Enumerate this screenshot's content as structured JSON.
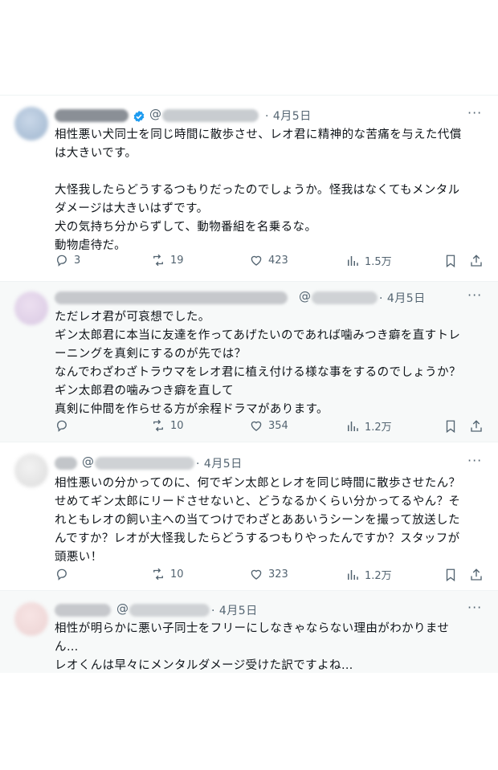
{
  "tweets": [
    {
      "at": "@",
      "date": "· 4月5日",
      "more": "···",
      "text": "相性悪い犬同士を同じ時間に散歩させ、レオ君に精神的な苦痛を与えた代償\nは大きいです。\n\n大怪我したらどうするつもりだったのでしょうか。怪我はなくてもメンタル\nダメージは大きいはずです。\n犬の気持ち分からずして、動物番組を名乗るな。\n動物虐待だ。",
      "replies": "3",
      "reposts": "19",
      "likes": "423",
      "views": "1.5万"
    },
    {
      "at": "@",
      "date": "· 4月5日",
      "more": "···",
      "text": "ただレオ君が可哀想でした。\nギン太郎君に本当に友達を作ってあげたいのであれば噛みつき癖を直すトレ\nーニングを真剣にするのが先では？\nなんでわざわざトラウマをレオ君に植え付ける様な事をするのでしょうか？\nギン太郎君の噛みつき癖を直して\n真剣に仲間を作らせる方が余程ドラマがあります。",
      "replies": "",
      "reposts": "10",
      "likes": "354",
      "views": "1.2万"
    },
    {
      "at": "@",
      "date": "· 4月5日",
      "more": "···",
      "text": "相性悪いの分かってのに、何でギン太郎とレオを同じ時間に散歩させたん？\nせめてギン太郎にリードさせないと、どうなるかくらい分かってるやん？そ\nれともレオの飼い主への当てつけでわざとああいうシーンを撮って放送した\nんですか？レオが大怪我したらどうするつもりやったんですか？スタッフが\n頭悪い！",
      "replies": "",
      "reposts": "10",
      "likes": "323",
      "views": "1.2万"
    },
    {
      "at": "@",
      "date": "· 4月5日",
      "more": "···",
      "text": "相性が明らかに悪い子同士をフリーにしなきゃならない理由がわかりませ\nん…\nレオくんは早々にメンタルダメージ受けた訳ですよね…"
    }
  ],
  "colors": {
    "text": "#0f1419",
    "muted": "#536471",
    "verified": "#1d9bf0",
    "border": "#eff3f4",
    "shaded": "#f7f9f9"
  }
}
